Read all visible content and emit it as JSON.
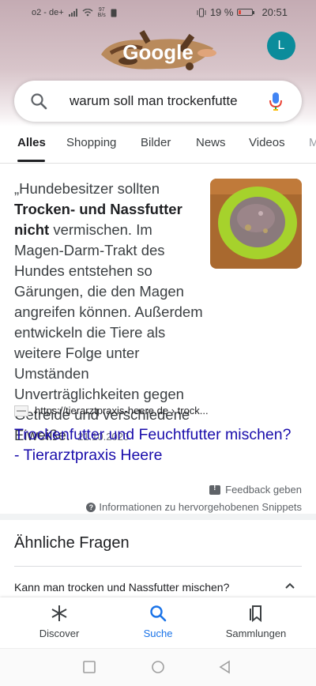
{
  "status_bar": {
    "carrier": "o2 - de+",
    "data_rate": "97",
    "data_unit": "B/s",
    "battery": "19 %",
    "time": "20:51",
    "battery_level": 0.19
  },
  "header": {
    "logo_text": "Google",
    "avatar_letter": "L"
  },
  "search": {
    "query": "warum soll man trockenfutte"
  },
  "tabs": [
    {
      "label": "Alles",
      "active": true
    },
    {
      "label": "Shopping"
    },
    {
      "label": "Bilder"
    },
    {
      "label": "News"
    },
    {
      "label": "Videos"
    },
    {
      "label": "M"
    }
  ],
  "snippet": {
    "part1": "„Hundebesitzer sollten ",
    "bold": "Trocken- und Nassfutter nicht",
    "part2": " vermischen. Im Magen-Darm-Trakt des Hundes entstehen so Gärungen, die den Magen angreifen können. Außerdem entwickeln die Tiere als weitere Folge unter Umständen Unverträglichkeiten gegen Getreide und verschiedene Eiweiße.",
    "date": "21.10.2020",
    "source_url": "https://tierarztpraxis-heere.de › trock...",
    "link_title": "Trockenfutter und Feuchtfutter mischen? - Tierarztpraxis Heere",
    "feedback": "Feedback geben",
    "info": "Informationen zu hervorgehobenen Snippets"
  },
  "related": {
    "title": "Ähnliche Fragen",
    "questions": [
      "Kann man trocken und Nassfutter mischen?"
    ]
  },
  "bottom_nav": [
    {
      "label": "Discover",
      "icon": "asterisk-icon"
    },
    {
      "label": "Suche",
      "icon": "search-icon",
      "active": true
    },
    {
      "label": "Sammlungen",
      "icon": "collections-icon"
    }
  ],
  "colors": {
    "link": "#1a0dab",
    "accent": "#1a73e8",
    "avatar": "#0b8c9b",
    "header_bg": "#c4abb3"
  }
}
